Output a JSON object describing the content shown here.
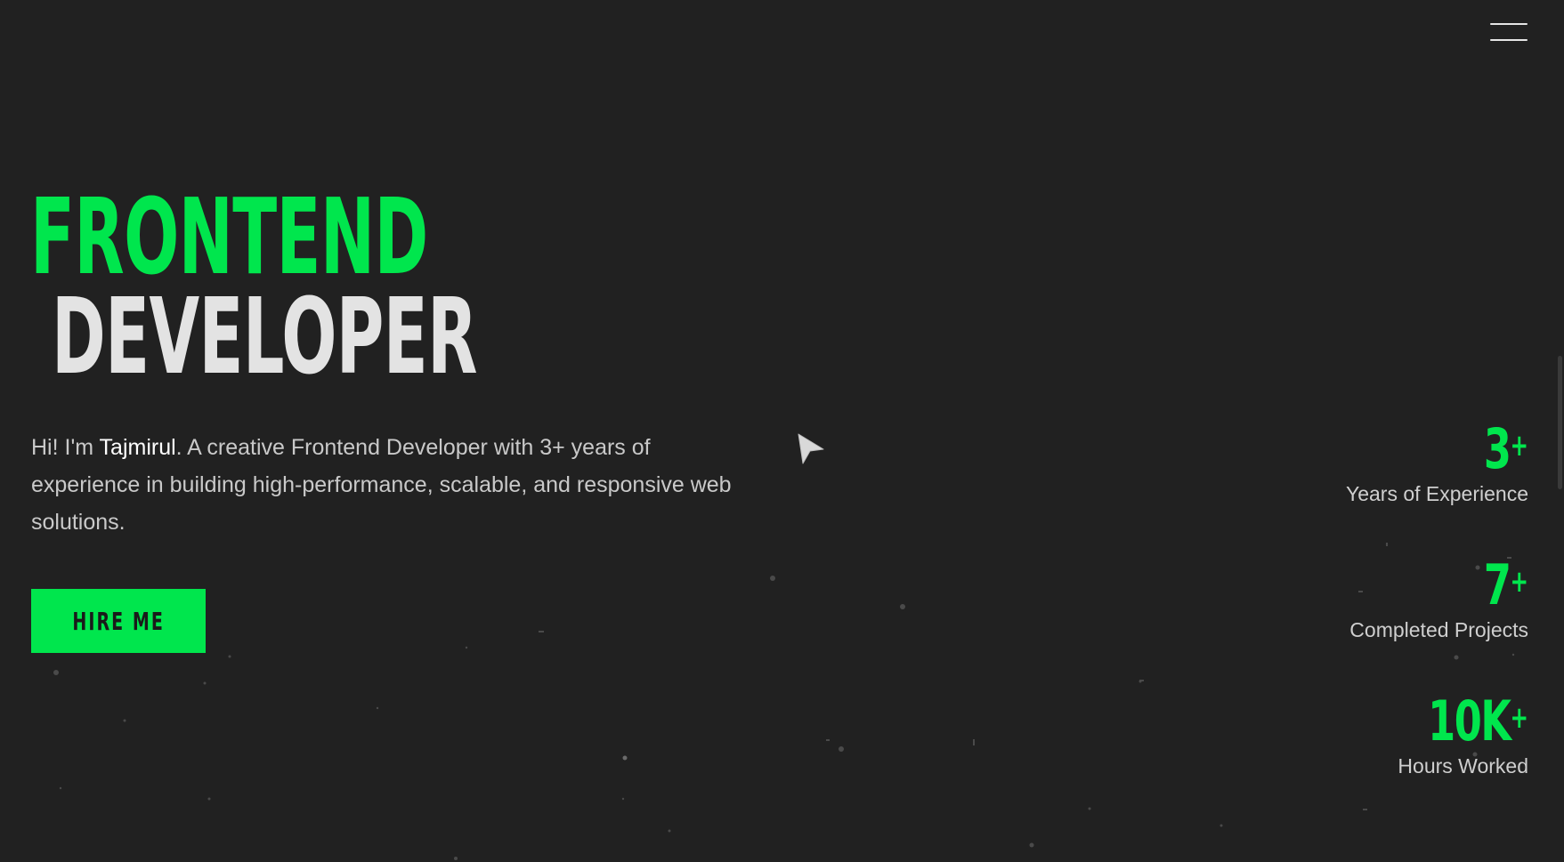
{
  "header": {
    "menu_icon": "hamburger-icon"
  },
  "hero": {
    "title_line1": "FRONTEND",
    "title_line2": "DEVELOPER",
    "intro_prefix": "Hi! I'm ",
    "intro_name": "Tajmirul",
    "intro_suffix": ". A creative Frontend Developer with 3+ years of experience in building high-performance, scalable, and responsive web solutions.",
    "cta_label": "HIRE ME"
  },
  "stats": [
    {
      "value": "3",
      "suffix": "+",
      "label": "Years of Experience"
    },
    {
      "value": "7",
      "suffix": "+",
      "label": "Completed Projects"
    },
    {
      "value": "10K",
      "suffix": "+",
      "label": "Hours Worked"
    }
  ],
  "colors": {
    "background": "#212121",
    "accent": "#00e64d",
    "title_secondary": "#e3e3e3",
    "body_text": "#c9c9c9"
  },
  "cursor_icon": "pointer-arrow-icon"
}
